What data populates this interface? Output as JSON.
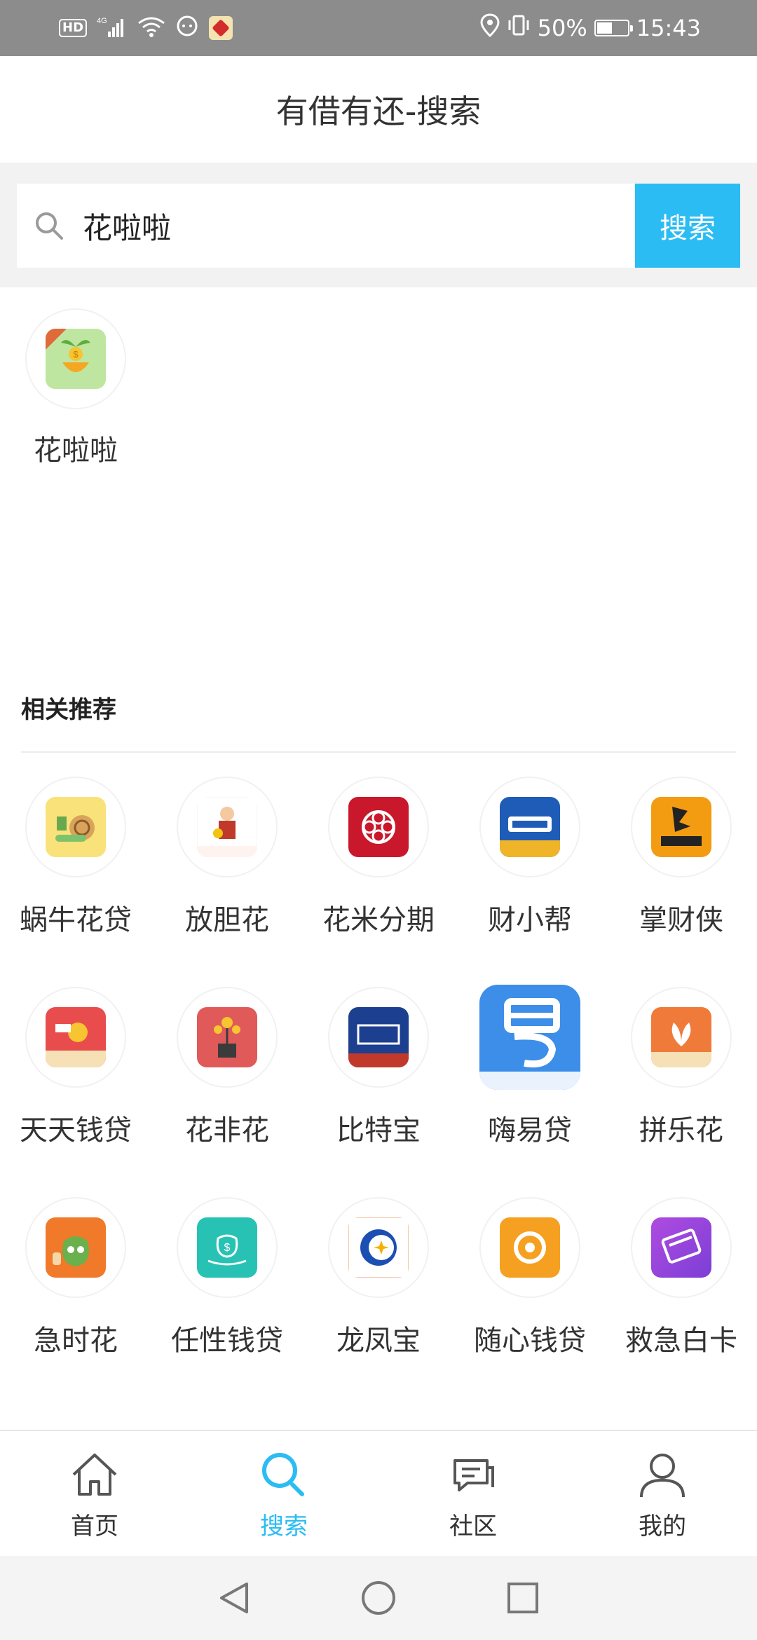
{
  "status_bar": {
    "hd": "HD",
    "network": "4G",
    "battery": "50%",
    "time": "15:43"
  },
  "header": {
    "title": "有借有还-搜索"
  },
  "search": {
    "value": "花啦啦",
    "button_label": "搜索"
  },
  "result": {
    "name": "花啦啦",
    "icon": "sprout-coin-icon"
  },
  "recommend": {
    "title": "相关推荐",
    "items": [
      {
        "name": "蜗牛花贷",
        "icon": "snail-icon"
      },
      {
        "name": "放胆花",
        "icon": "person-money-icon"
      },
      {
        "name": "花米分期",
        "icon": "flower-pattern-icon"
      },
      {
        "name": "财小帮",
        "icon": "caixiaobang-logo-icon"
      },
      {
        "name": "掌财侠",
        "icon": "ninja-logo-icon"
      },
      {
        "name": "天天钱贷",
        "icon": "hand-coin-icon"
      },
      {
        "name": "花非花",
        "icon": "money-plant-icon"
      },
      {
        "name": "比特宝",
        "icon": "bitebao-logo-icon"
      },
      {
        "name": "嗨易贷",
        "icon": "yi-logo-icon"
      },
      {
        "name": "拼乐花",
        "icon": "leaf-logo-icon"
      },
      {
        "name": "急时花",
        "icon": "money-bag-thumb-icon"
      },
      {
        "name": "任性钱贷",
        "icon": "money-bag-hand-icon"
      },
      {
        "name": "龙凤宝",
        "icon": "circle-star-icon"
      },
      {
        "name": "随心钱贷",
        "icon": "coin-ring-icon"
      },
      {
        "name": "救急白卡",
        "icon": "card-icon"
      }
    ]
  },
  "colors": {
    "accent": "#2bbcf3",
    "status_bar": "#8c8c8c"
  },
  "bottom_nav": [
    {
      "label": "首页",
      "icon": "home-icon",
      "active": false
    },
    {
      "label": "搜索",
      "icon": "search-icon",
      "active": true
    },
    {
      "label": "社区",
      "icon": "chat-icon",
      "active": false
    },
    {
      "label": "我的",
      "icon": "user-icon",
      "active": false
    }
  ]
}
